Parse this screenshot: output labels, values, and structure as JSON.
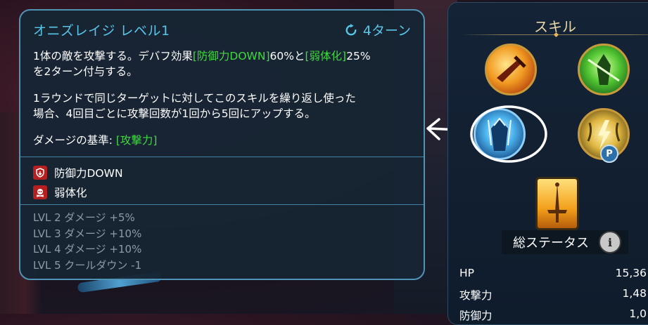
{
  "tooltip": {
    "title": "オニズレイジ レベル1",
    "cooldown": "4ターン",
    "desc": {
      "line1_a": "1体の敵を攻撃する。デバフ効果",
      "line1_b": "[防御力DOWN]",
      "line1_c": "60%と",
      "line1_d": "[弱体化]",
      "line1_e": "25%",
      "line2": "を2ターン付与する。",
      "line3": "1ラウンドで同じターゲットに対してこのスキルを繰り返し使った",
      "line4": "場合、4回目ごとに攻撃回数が1回から5回にアップする。",
      "basis_label": "ダメージの基準: ",
      "basis_value": "[攻撃力]"
    },
    "effects": [
      {
        "icon": "shield-down-icon",
        "label": "防御力DOWN"
      },
      {
        "icon": "skull-weaken-icon",
        "label": "弱体化"
      }
    ],
    "levels": [
      "LVL 2 ダメージ +5%",
      "LVL 3 ダメージ +10%",
      "LVL 4 ダメージ +10%",
      "LVL 5 クールダウン -1"
    ]
  },
  "panel": {
    "title": "スキル",
    "stats_title": "総ステータス",
    "info_symbol": "i",
    "passive_badge": "P",
    "stats": [
      {
        "label": "HP",
        "value": "15,36"
      },
      {
        "label": "攻撃力",
        "value": "1,48"
      },
      {
        "label": "防御力",
        "value": "1,0"
      }
    ]
  },
  "colors": {
    "accent_blue": "#58c6e9",
    "highlight_green": "#40d940",
    "level_gray": "#8f9aa6",
    "border": "#4f93b6"
  }
}
